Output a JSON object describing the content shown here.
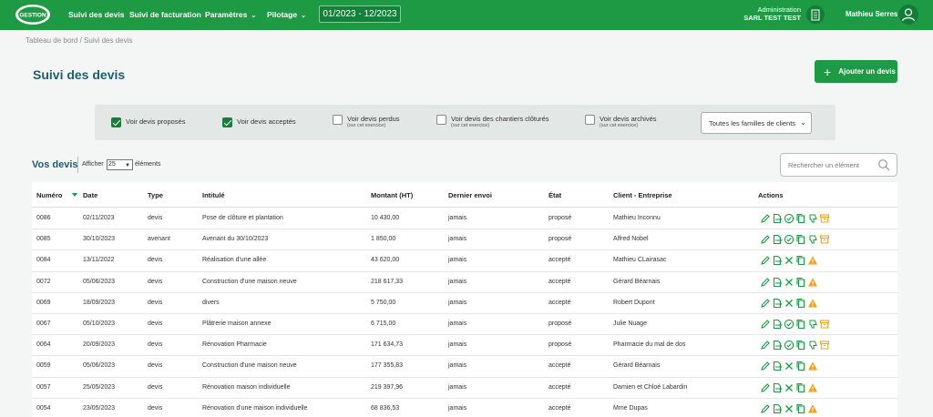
{
  "topbar": {
    "logo_text": "GESTION",
    "nav": [
      {
        "label": "Suivi des devis"
      },
      {
        "label": "Suivi de facturation"
      },
      {
        "label": "Paramètres"
      },
      {
        "label": "Pilotage"
      }
    ],
    "period": "01/2023 - 12/2023",
    "admin_line1": "Administration",
    "admin_line2": "SARL TEST TEST",
    "user_name": "Mathieu Serres"
  },
  "breadcrumb": "Tableau de bord / Suivi des devis",
  "page_title": "Suivi des devis",
  "add_button": "Ajouter un devis",
  "filters": {
    "proposes": {
      "label": "Voir devis proposés",
      "checked": true
    },
    "acceptes": {
      "label": "Voir devis acceptés",
      "checked": true
    },
    "perdus": {
      "label": "Voir devis perdus",
      "sub": "(sur cet exercice)",
      "checked": false
    },
    "clotures": {
      "label": "Voir devis des chantiers clôturés",
      "sub": "(sur cet exercice)",
      "checked": false
    },
    "archives": {
      "label": "Voir devis archivés",
      "sub": "(sur cet exercice)",
      "checked": false
    },
    "family_select": "Toutes les familles de clients"
  },
  "list": {
    "title": "Vos devis",
    "show_label": "Afficher",
    "page_size": "25",
    "elements_label": "éléments",
    "search_placeholder": "Rechercher un élément"
  },
  "columns": {
    "numero": "Numéro",
    "date": "Date",
    "type": "Type",
    "intitule": "Intitulé",
    "montant": "Montant (HT)",
    "envoi": "Dernier envoi",
    "etat": "État",
    "client": "Client - Entreprise",
    "actions": "Actions"
  },
  "rows": [
    {
      "numero": "0086",
      "date": "02/11/2023",
      "type": "devis",
      "intitule": "Pose de clôture et plantation",
      "montant": "10 430,00",
      "envoi": "jamais",
      "etat": "proposé",
      "client": "Mathieu Inconnu"
    },
    {
      "numero": "0085",
      "date": "30/10/2023",
      "type": "avenant",
      "intitule": "Avenant du 30/10/2023",
      "montant": "1 850,00",
      "envoi": "jamais",
      "etat": "proposé",
      "client": "Alfred Nobel"
    },
    {
      "numero": "0084",
      "date": "13/11/2022",
      "type": "devis",
      "intitule": "Réalisation d'une allée",
      "montant": "43 620,00",
      "envoi": "jamais",
      "etat": "accepté",
      "client": "Mathieu CLairasac"
    },
    {
      "numero": "0072",
      "date": "05/06/2023",
      "type": "devis",
      "intitule": "Construction d'une maison neuve",
      "montant": "218 617,33",
      "envoi": "jamais",
      "etat": "accepté",
      "client": "Gérard Béarnais"
    },
    {
      "numero": "0069",
      "date": "18/09/2023",
      "type": "devis",
      "intitule": "divers",
      "montant": "5 750,00",
      "envoi": "jamais",
      "etat": "accepté",
      "client": "Robert Dupont"
    },
    {
      "numero": "0067",
      "date": "05/10/2023",
      "type": "devis",
      "intitule": "Plâtrerie maison annexe",
      "montant": "6 715,00",
      "envoi": "jamais",
      "etat": "proposé",
      "client": "Julie Nuage"
    },
    {
      "numero": "0064",
      "date": "20/09/2023",
      "type": "devis",
      "intitule": "Rénovation Pharmacie",
      "montant": "171 634,73",
      "envoi": "jamais",
      "etat": "proposé",
      "client": "Pharmacie du mal de dos"
    },
    {
      "numero": "0059",
      "date": "05/06/2023",
      "type": "devis",
      "intitule": "Construction d'une maison neuve",
      "montant": "177 355,83",
      "envoi": "jamais",
      "etat": "accepté",
      "client": "Gérard Béarnais"
    },
    {
      "numero": "0057",
      "date": "25/05/2023",
      "type": "devis",
      "intitule": "Rénovation maison individuelle",
      "montant": "219 397,96",
      "envoi": "jamais",
      "etat": "accepté",
      "client": "Damien et Chloé Labardin"
    },
    {
      "numero": "0054",
      "date": "23/05/2023",
      "type": "devis",
      "intitule": "Rénovation d'une maison individuelle",
      "montant": "68 836,53",
      "envoi": "jamais",
      "etat": "accepté",
      "client": "Mme Dupas"
    }
  ],
  "colors": {
    "brand_green": "#1e9a45",
    "title_blue": "#1f5e6c",
    "warning_orange": "#f0a21b"
  }
}
